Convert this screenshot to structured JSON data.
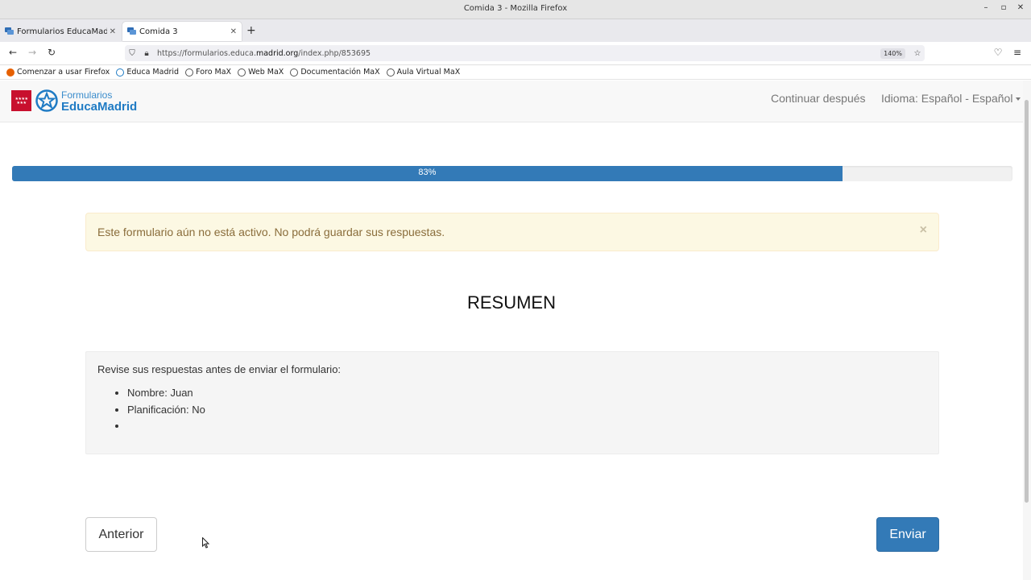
{
  "window": {
    "title": "Comida 3 - Mozilla Firefox",
    "controls": [
      "–",
      "▫",
      "✕"
    ]
  },
  "tabs": [
    {
      "label": "Formularios EducaMadrid",
      "active": false
    },
    {
      "label": "Comida 3",
      "active": true
    }
  ],
  "navbar": {
    "url_prefix": "https://formularios.educa.",
    "url_domain": "madrid.org",
    "url_suffix": "/index.php/853695",
    "zoom": "140%"
  },
  "bookmarks": [
    {
      "label": "Comenzar a usar Firefox",
      "icon": "firefox-icon"
    },
    {
      "label": "Educa Madrid",
      "icon": "educamadrid-icon"
    },
    {
      "label": "Foro MaX",
      "icon": "globe-icon"
    },
    {
      "label": "Web MaX",
      "icon": "globe-icon"
    },
    {
      "label": "Documentación MaX",
      "icon": "globe-icon"
    },
    {
      "label": "Aula Virtual MaX",
      "icon": "globe-icon"
    }
  ],
  "site": {
    "logo_small": "Formularios",
    "logo_big": "EducaMadrid",
    "nav_continue": "Continuar después",
    "nav_language": "Idioma: Español - Español"
  },
  "progress": {
    "value": 0.83,
    "label": "83%"
  },
  "alert": {
    "message": "Este formulario aún no está activo. No podrá guardar sus respuestas.",
    "close": "×"
  },
  "summary": {
    "heading": "RESUMEN",
    "intro": "Revise sus respuestas antes de enviar el formulario:",
    "items": [
      "Nombre: Juan",
      "Planificación: No",
      ""
    ]
  },
  "buttons": {
    "previous": "Anterior",
    "submit": "Enviar"
  },
  "colors": {
    "primary": "#337ab7",
    "alert_bg": "#fcf8e3",
    "alert_text": "#8a6d3b",
    "brand_red": "#c8102e",
    "brand_blue": "#1f7bc4"
  }
}
